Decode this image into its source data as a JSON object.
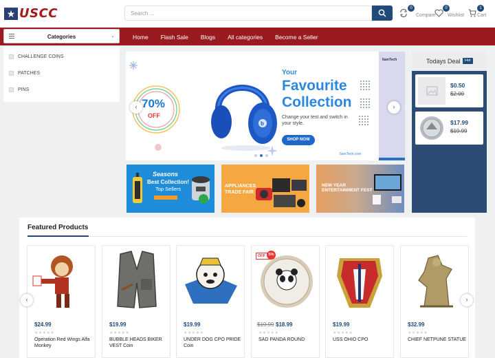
{
  "header": {
    "logo_text": "USCC",
    "search_placeholder": "Search ...",
    "compare": {
      "label": "Compare",
      "count": "0"
    },
    "wishlist": {
      "label": "Wishlist",
      "count": "0"
    },
    "cart": {
      "label": "Cart",
      "count": "1"
    }
  },
  "nav": {
    "categories_label": "Categories",
    "links": [
      "Home",
      "Flash Sale",
      "Blogs",
      "All categories",
      "Become a Seller"
    ]
  },
  "categories": [
    "CHALLENGE COINS",
    "PATCHES",
    "PINS"
  ],
  "hero": {
    "brand": "6amTech",
    "percent": "70%",
    "off": "OFF",
    "your": "Your",
    "title_line1": "Favourite",
    "title_line2": "Collection",
    "subtitle": "Change your test and switch in your style.",
    "button": "SHOP NOW",
    "site": "6amTech.com"
  },
  "banners": [
    {
      "line1": "Seasons",
      "line2": "Best Collection!",
      "line3": "Top Sellers",
      "colors": "#1e8cd8"
    },
    {
      "line1": "APPLIANCES",
      "line2": "TRADE FAIR",
      "colors": "#f5a742"
    },
    {
      "line1": "NEW YEAR",
      "line2": "ENTERTAINMENT FEST",
      "colors": "#6e8ec0"
    }
  ],
  "todays_deal": {
    "title": "Todays Deal",
    "badge": "Hot",
    "items": [
      {
        "price": "$0.50",
        "old_price": "$2.00"
      },
      {
        "price": "$17.99",
        "old_price": "$19.99"
      }
    ]
  },
  "featured": {
    "title": "Featured Products",
    "products": [
      {
        "price": "$24.99",
        "name": "Operation Red Wings Alfa Monkey"
      },
      {
        "price": "$19.99",
        "name": "BUBBLE HEADS BIKER VEST Coin"
      },
      {
        "price": "$19.99",
        "name": "UNDER DOG CPO PRIDE Coin"
      },
      {
        "old_price": "$19.99",
        "price": "$18.99",
        "name": "SAD PANDA ROUND",
        "off_label": "OFF",
        "off_pct": "5%"
      },
      {
        "price": "$19.99",
        "name": "USS OHIO CPO"
      },
      {
        "price": "$32.99",
        "name": "CHIEF NETPUNE STATUE"
      }
    ]
  },
  "colors": {
    "primary": "#1f4a7a",
    "nav_bg": "#9a1b1f",
    "deal_bg": "#2c4b75",
    "accent_blue": "#2a88e0",
    "logo_red": "#a31b1b"
  }
}
